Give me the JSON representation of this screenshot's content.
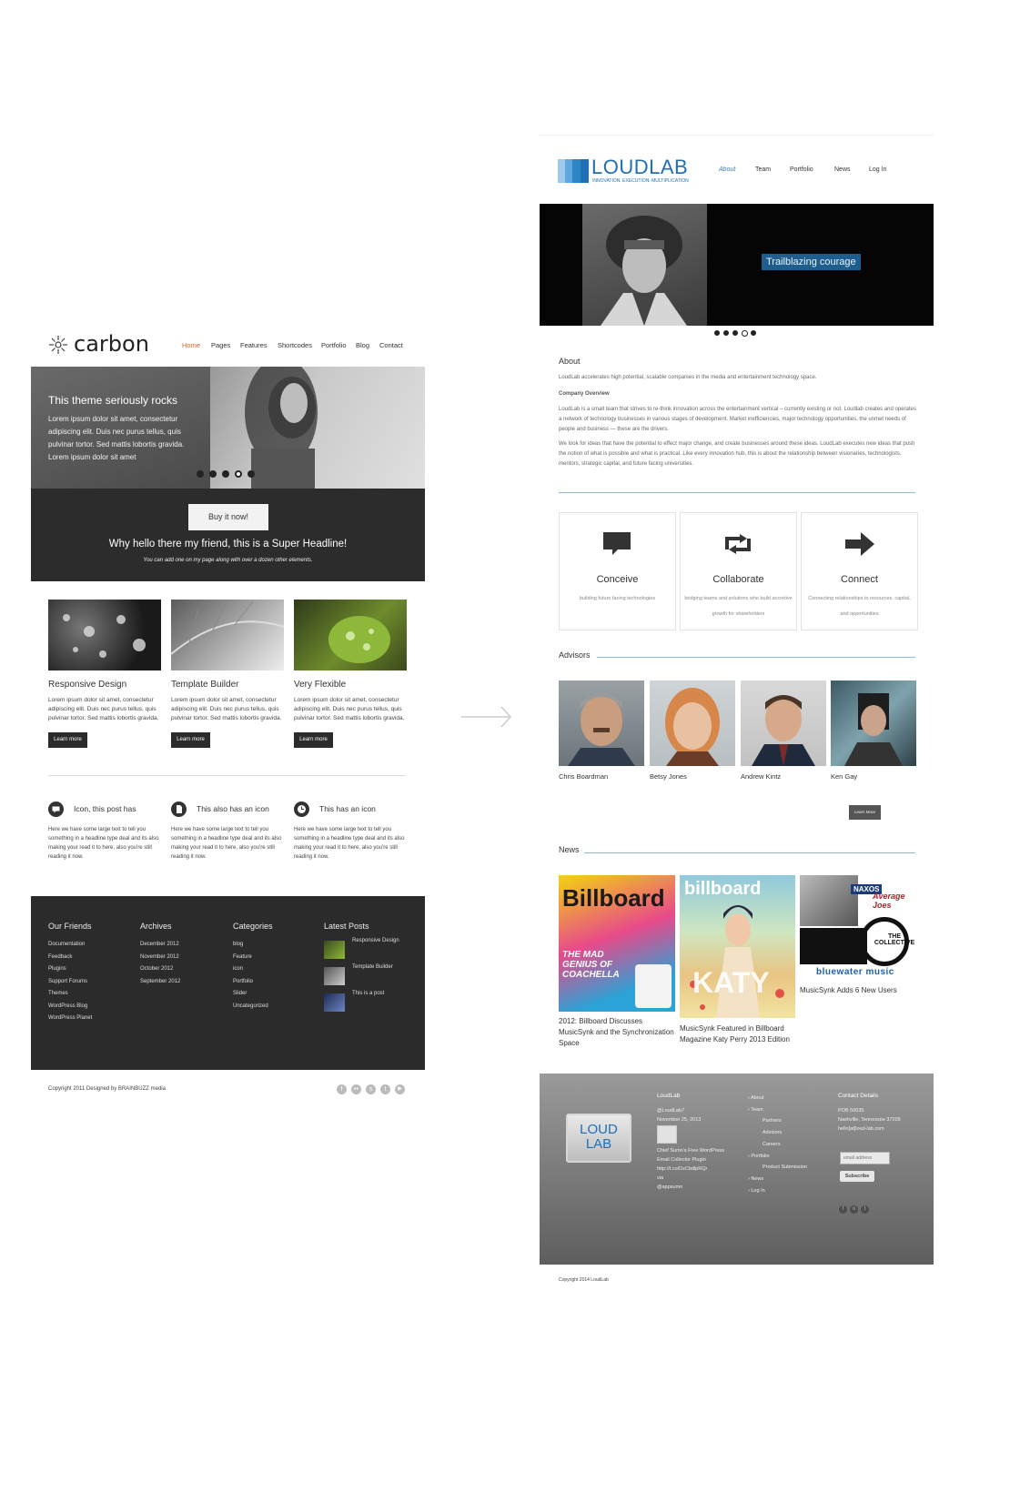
{
  "carbon": {
    "logo_text": "carbon",
    "nav": [
      "Home",
      "Pages",
      "Features",
      "Shortcodes",
      "Portfolio",
      "Blog",
      "Contact"
    ],
    "hero": {
      "title": "This theme seriously rocks",
      "text": "Lorem ipsum dolor sit amet, consectetur adipiscing elit. Duis nec purus tellus, quis pulvinar tortor. Sed mattis lobortis gravida. Lorem ipsum dolor sit amet",
      "button": "Buy it now!",
      "headline": "Why hello there my friend, this is a Super Headline!",
      "subline": "You can add one on my page along with over a dozen other elements."
    },
    "features": [
      {
        "title": "Responsive Design",
        "text": "Lorem ipsum dolor sit amet, consectetur adipiscing elit. Duis nec purus tellus, quis pulvinar tortor. Sed mattis lobortis gravida.",
        "button": "Learn more"
      },
      {
        "title": "Template Builder",
        "text": "Lorem ipsum dolor sit amet, consectetur adipiscing elit. Duis nec purus tellus, quis pulvinar tortor. Sed mattis lobortis gravida.",
        "button": "Learn more"
      },
      {
        "title": "Very Flexible",
        "text": "Lorem ipsum dolor sit amet, consectetur adipiscing elit. Duis nec purus tellus, quis pulvinar tortor. Sed mattis lobortis gravida.",
        "button": "Learn more"
      }
    ],
    "icon_posts": [
      {
        "title": "Icon, this post has",
        "icon": "chat-icon",
        "text": "Here we have some large text to tell you something in a headline type deal and its also making your read it to here, also you're still reading it now."
      },
      {
        "title": "This also has an icon",
        "icon": "document-icon",
        "text": "Here we have some large text to tell you something in a headline type deal and its also making your read it to here, also you're still reading it now."
      },
      {
        "title": "This has an icon",
        "icon": "clock-icon",
        "text": "Here we have some large text to tell you something in a headline type deal and its also making your read it to here, also you're still reading it now."
      }
    ],
    "footer": {
      "friends": {
        "title": "Our Friends",
        "items": [
          "Documentation",
          "Feedback",
          "Plugins",
          "Support Forums",
          "Themes",
          "WordPress Blog",
          "WordPress Planet"
        ]
      },
      "archives": {
        "title": "Archives",
        "items": [
          "December 2012",
          "November 2012",
          "October 2012",
          "September 2012"
        ]
      },
      "categories": {
        "title": "Categories",
        "items": [
          "blog",
          "Feature",
          "icon",
          "Portfolio",
          "Slider",
          "Uncategorized"
        ]
      },
      "latest": {
        "title": "Latest Posts",
        "items": [
          "Responsive Design",
          "Template Builder",
          "This is a post"
        ]
      }
    },
    "copyright": "Copyright 2011 Designed by BRAINBUZZ media",
    "social_icons": [
      "facebook-icon",
      "flickr-icon",
      "skype-icon",
      "twitter-icon",
      "youtube-icon"
    ]
  },
  "loudlab": {
    "logo_text": "LOUDLAB",
    "logo_tagline": "INNOVATION. EXECUTION. MULTIPLICATION",
    "nav": [
      "About",
      "Team",
      "Portfolio",
      "News",
      "Log In"
    ],
    "hero_caption": "Trailblazing courage",
    "about": {
      "heading": "About",
      "intro": "LoudLab accelerates high potential, scalable companies in the media and entertainment technology space.",
      "overview_heading": "Company Overview",
      "p1": "LoudLab is a small team that strives to re-think innovation across the entertainment vertical – currently existing or not. Loudlab creates and operates a network of technology businesses in various stages of development. Market inefficiencies, major technology opportunities, the unmet needs of people and business — these are the drivers.",
      "p2": "We look for ideas that have the potential to effect major change, and create businesses around these ideas. LoudLab executes new ideas that push the notion of what is possible and what is practical. Like every innovation hub, this is about the relationship between visionaries, technologists, mentors, strategic capital, and future facing universities."
    },
    "services": [
      {
        "title": "Conceive",
        "sub": "building future facing technologies",
        "icon": "speech-bubble-icon"
      },
      {
        "title": "Collaborate",
        "sub": "bridging teams and solutions who build accretive growth for shareholders",
        "icon": "retweet-arrows-icon"
      },
      {
        "title": "Connect",
        "sub": "Connecting relationships to resources, capital, and opportunities",
        "icon": "arrow-right-icon"
      }
    ],
    "advisors_heading": "Advisors",
    "advisors": [
      "Chris Boardman",
      "Betsy Jones",
      "Andrew Kintz",
      "Ken Gay"
    ],
    "learn_more": "Learn More",
    "news_heading": "News",
    "news": [
      {
        "caption": "2012: Billboard Discusses MusicSynk and the Synchronization Space",
        "magazine": "Billboard",
        "cover_text": "THE MAD GENIUS OF COACHELLA"
      },
      {
        "caption": "MusicSynk Featured in Billboard Magazine Katy Perry 2013 Edition",
        "magazine": "billboard",
        "cover_text": "KATY"
      },
      {
        "caption": "MusicSynk Adds 6 New Users",
        "magazine": "",
        "cover_text": ""
      }
    ],
    "news3_logos": [
      "NAXOS",
      "Average Joes",
      "THE COLLECTIVE",
      "bluewater music"
    ],
    "footer": {
      "logo_text": "LOUD LAB",
      "col1_heading": "LoudLab",
      "col1_lines": [
        "@LoudLab7",
        "November 25, 2013",
        "Chief Sumo's Free WordPress",
        "Email Collector Plugin",
        "http://t.co/DzCbdlpRQr",
        "via",
        "@appsumo"
      ],
      "menu": [
        "About",
        "Team",
        "Partners",
        "Advisors",
        "Careers",
        "Portfolio",
        "Product Submission",
        "News",
        "Log In"
      ],
      "contact_heading": "Contact Details",
      "contact_lines": [
        "POB 50035",
        "Nashville, Tennessee 37205",
        "hello[at]loud-lab.com"
      ],
      "email_placeholder": "email address",
      "subscribe": "Subscribe"
    },
    "copyright": "Copyright 2014 LoudLab"
  },
  "colors": {
    "accent_orange": "#d9632b",
    "loudlab_blue": "#1e6fb6",
    "dark": "#2b2b2b"
  }
}
